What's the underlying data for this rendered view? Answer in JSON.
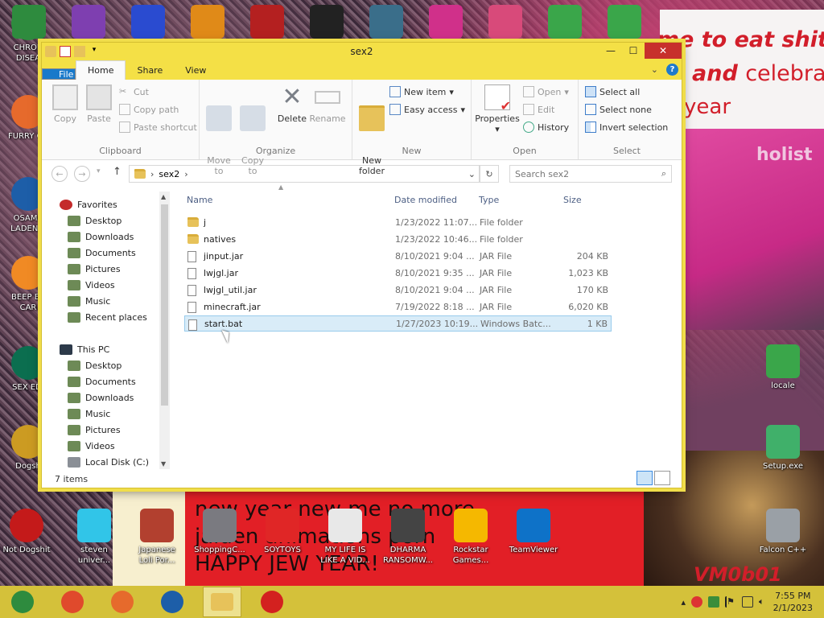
{
  "desktop": {
    "banner": {
      "line1": "'s time to eat shit",
      "line2a": "and",
      "line2b": "celebra",
      "line3": "year"
    },
    "pink_text": "holist",
    "bottom_text": {
      "line1": "new year new me no more",
      "line2": "jaiden animations porn",
      "line3": "HAPPY JEW YEAR!"
    },
    "watermark": "VM0b01",
    "left_icons": [
      {
        "label": "CHRON\nDISEA",
        "color": "#2e8b3e"
      },
      {
        "label": "FURRY CU",
        "color": "#e66a2c"
      },
      {
        "label": "OSAMA\nLADEN E",
        "color": "#1d5ea8"
      },
      {
        "label": "BEEP BE\nCAR",
        "color": "#f08a24"
      },
      {
        "label": "SEX EDI",
        "color": "#0b6e4f"
      },
      {
        "label": "Dogsh",
        "color": "#cc9b22"
      },
      {
        "label": "Not Dogshit",
        "color": "#c41a1a"
      }
    ],
    "bottom_icons": [
      {
        "label": "steven\nuniver...",
        "color": "#31c5e8"
      },
      {
        "label": "Japanese\nLoli Por...",
        "color": "#b2402f"
      },
      {
        "label": "ShoppingC...",
        "color": "#7a7a80"
      },
      {
        "label": "SOYTOYS",
        "color": "#e02626"
      },
      {
        "label": "MY LIFE IS\nLIKE A VID...",
        "color": "#e8e8e8"
      },
      {
        "label": "DHARMA\nRANSOMW...",
        "color": "#444"
      },
      {
        "label": "Rockstar\nGames...",
        "color": "#f5b800"
      },
      {
        "label": "TeamViewer",
        "color": "#0e72c8"
      }
    ],
    "right_icons": [
      {
        "label": "locale",
        "color": "#3aa64a"
      },
      {
        "label": "Setup.exe",
        "color": "#40b06a"
      },
      {
        "label": "Falcon C++",
        "color": "#9aa0a6"
      }
    ],
    "top_icons": [
      {
        "color": "#2e8b3e"
      },
      {
        "color": "#7e3fb0"
      },
      {
        "color": "#2a4bd0"
      },
      {
        "color": "#e08a18"
      },
      {
        "color": "#b42020"
      },
      {
        "color": "#222"
      },
      {
        "color": "#3a6e8a"
      },
      {
        "color": "#d0308a"
      },
      {
        "color": "#d84a7a"
      },
      {
        "color": "#3aa64a"
      },
      {
        "color": "#3aa64a"
      }
    ]
  },
  "explorer": {
    "title": "sex2",
    "tabs": {
      "file": "File",
      "home": "Home",
      "share": "Share",
      "view": "View"
    },
    "ribbon": {
      "clipboard": {
        "label": "Clipboard",
        "copy": "Copy",
        "paste": "Paste",
        "cut": "Cut",
        "copy_path": "Copy path",
        "paste_shortcut": "Paste shortcut"
      },
      "organize": {
        "label": "Organize",
        "move_to": "Move\nto",
        "copy_to": "Copy\nto",
        "delete": "Delete",
        "rename": "Rename"
      },
      "new": {
        "label": "New",
        "new_folder": "New\nfolder",
        "new_item": "New item",
        "easy_access": "Easy access"
      },
      "open": {
        "label": "Open",
        "properties": "Properties",
        "open": "Open",
        "edit": "Edit",
        "history": "History"
      },
      "select": {
        "label": "Select",
        "select_all": "Select all",
        "select_none": "Select none",
        "invert": "Invert selection"
      }
    },
    "address": {
      "path": "sex2"
    },
    "search": {
      "placeholder": "Search sex2"
    },
    "columns": {
      "name": "Name",
      "date": "Date modified",
      "type": "Type",
      "size": "Size"
    },
    "nav": {
      "favorites": "Favorites",
      "fav_items": [
        "Desktop",
        "Downloads",
        "Documents",
        "Pictures",
        "Videos",
        "Music",
        "Recent places"
      ],
      "thispc": "This PC",
      "pc_items": [
        "Desktop",
        "Documents",
        "Downloads",
        "Music",
        "Pictures",
        "Videos",
        "Local Disk (C:)"
      ]
    },
    "files": [
      {
        "name": "j",
        "date": "1/23/2022 11:07...",
        "type": "File folder",
        "size": "",
        "kind": "folder"
      },
      {
        "name": "natives",
        "date": "1/23/2022 10:46...",
        "type": "File folder",
        "size": "",
        "kind": "folder"
      },
      {
        "name": "jinput.jar",
        "date": "8/10/2021 9:04 ...",
        "type": "JAR File",
        "size": "204 KB",
        "kind": "file"
      },
      {
        "name": "lwjgl.jar",
        "date": "8/10/2021 9:35 ...",
        "type": "JAR File",
        "size": "1,023 KB",
        "kind": "file"
      },
      {
        "name": "lwjgl_util.jar",
        "date": "8/10/2021 9:04 ...",
        "type": "JAR File",
        "size": "170 KB",
        "kind": "file"
      },
      {
        "name": "minecraft.jar",
        "date": "7/19/2022 8:18 ...",
        "type": "JAR File",
        "size": "6,020 KB",
        "kind": "file"
      },
      {
        "name": "start.bat",
        "date": "1/27/2023 10:19...",
        "type": "Windows Batc...",
        "size": "1 KB",
        "kind": "bat",
        "selected": true
      }
    ],
    "status": "7 items"
  },
  "taskbar": {
    "apps": [
      {
        "name": "chrome-alt",
        "color": "#2e8b3e"
      },
      {
        "name": "chrome",
        "color": "#e04a2c"
      },
      {
        "name": "firefox",
        "color": "#e66a2c"
      },
      {
        "name": "obama",
        "color": "#1d5ea8"
      },
      {
        "name": "explorer",
        "color": "#e7c25a",
        "active": true
      },
      {
        "name": "opera",
        "color": "#d3211f"
      }
    ],
    "time": "7:55 PM",
    "date": "2/1/2023"
  }
}
